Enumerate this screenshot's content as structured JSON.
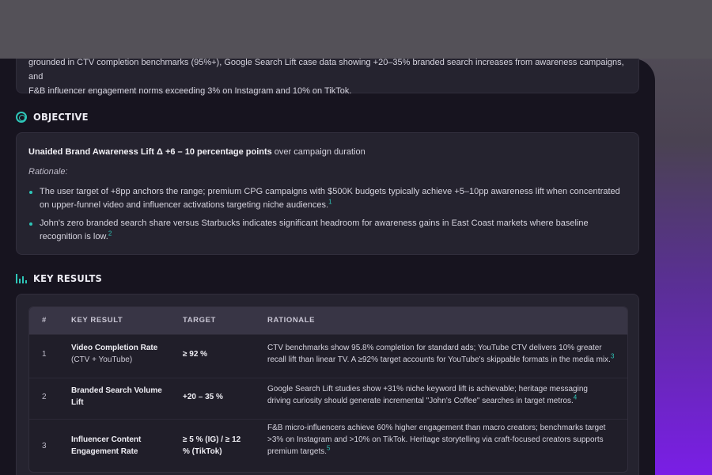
{
  "summary": {
    "line1": "grounded in CTV completion benchmarks (95%+), Google Search Lift case data showing +20–35% branded search increases from awareness campaigns, and",
    "line2": "F&B influencer engagement norms exceeding 3% on Instagram and 10% on TikTok."
  },
  "objective": {
    "heading": "OBJECTIVE",
    "metric_bold": "Unaided Brand Awareness Lift Δ +6 – 10 percentage points",
    "metric_rest": " over campaign duration",
    "rationale_label": "Rationale:",
    "bullets": [
      {
        "text": "The user target of +8pp anchors the range; premium CPG campaigns with $500K budgets typically achieve +5–10pp awareness lift when concentrated on upper-funnel video and influencer activations targeting niche audiences.",
        "ref": "1"
      },
      {
        "text": "John's zero branded search share versus Starbucks indicates significant headroom for awareness gains in East Coast markets where baseline recognition is low.",
        "ref": "2"
      }
    ]
  },
  "key_results": {
    "heading": "KEY RESULTS",
    "columns": [
      "#",
      "KEY RESULT",
      "TARGET",
      "RATIONALE"
    ],
    "rows": [
      {
        "num": "1",
        "name": "Video Completion Rate",
        "name_sub": "(CTV + YouTube)",
        "target": "≥ 92 %",
        "rationale": "CTV benchmarks show 95.8% completion for standard ads; YouTube CTV delivers 10% greater recall lift than linear TV. A ≥92% target accounts for YouTube's skippable formats in the media mix.",
        "ref": "3"
      },
      {
        "num": "2",
        "name": "Branded Search Volume",
        "name_sub": "Lift",
        "target": "+20 – 35 %",
        "rationale": "Google Search Lift studies show +31% niche keyword lift is achievable; heritage messaging driving curiosity should generate incremental \"John's Coffee\" searches in target metros.",
        "ref": "4"
      },
      {
        "num": "3",
        "name": "Influencer Content",
        "name_sub": "Engagement Rate",
        "target": "≥ 5 % (IG) / ≥ 12 % (TikTok)",
        "rationale": "F&B micro-influencers achieve 60% higher engagement than macro creators; benchmarks target >3% on Instagram and >10% on TikTok. Heritage storytelling via craft-focused creators supports premium targets.",
        "ref": "5"
      }
    ]
  },
  "colors": {
    "accent": "#2ec6b8",
    "panel": "#17141f",
    "card": "#25232f",
    "gradient_end": "#7a1ee6"
  }
}
